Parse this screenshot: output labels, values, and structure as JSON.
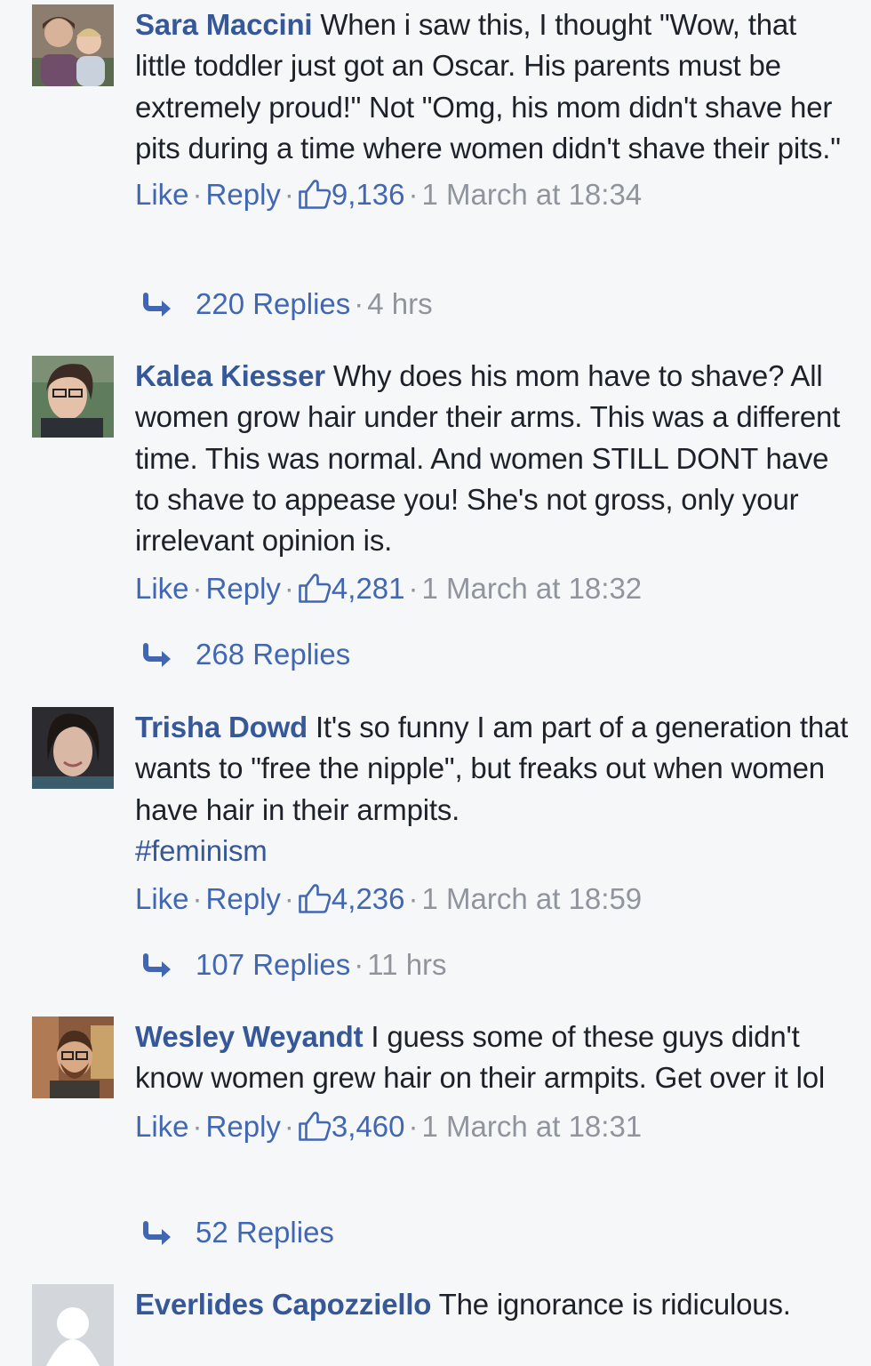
{
  "comments": [
    {
      "author": "Sara Maccini",
      "text": "When i saw this, I thought \"Wow, that little toddler just got an Oscar. His parents must be extremely proud!\" Not \"Omg, his mom didn't shave her pits during a time where women didn't shave their pits.\"",
      "hashtag": "",
      "like_label": "Like",
      "reply_label": "Reply",
      "likes": "9,136",
      "time": "1 March at 18:34",
      "replies_label": "220 Replies",
      "replies_time": "4 hrs"
    },
    {
      "author": "Kalea Kiesser",
      "text": "Why does his mom have to shave? All women grow hair under their arms. This was a different time. This was normal. And women STILL DONT have to shave to appease you! She's not gross, only your irrelevant opinion is.",
      "hashtag": "",
      "like_label": "Like",
      "reply_label": "Reply",
      "likes": "4,281",
      "time": "1 March at 18:32",
      "replies_label": "268 Replies",
      "replies_time": ""
    },
    {
      "author": "Trisha Dowd",
      "text": "It's so funny I am part of a generation that wants to \"free the nipple\", but freaks out when women have hair in their armpits.",
      "hashtag": "#feminism",
      "like_label": "Like",
      "reply_label": "Reply",
      "likes": "4,236",
      "time": "1 March at 18:59",
      "replies_label": "107 Replies",
      "replies_time": "11 hrs"
    },
    {
      "author": "Wesley Weyandt",
      "text": "I guess some of these guys didn't know women grew hair on their armpits. Get over it lol",
      "hashtag": "",
      "like_label": "Like",
      "reply_label": "Reply",
      "likes": "3,460",
      "time": "1 March at 18:31",
      "replies_label": "52 Replies",
      "replies_time": ""
    },
    {
      "author": "Everlides Capozziello",
      "text": "The ignorance is ridiculous.",
      "hashtag": "",
      "like_label": "",
      "reply_label": "",
      "likes": "",
      "time": "",
      "replies_label": "",
      "replies_time": ""
    }
  ],
  "colors": {
    "link": "#365899",
    "action": "#4267b2",
    "meta": "#90949c",
    "text": "#1d2129",
    "background": "#f6f7f9"
  },
  "icons": {
    "like": "thumbs-up-icon",
    "reply_arrow": "reply-arrow-icon"
  }
}
